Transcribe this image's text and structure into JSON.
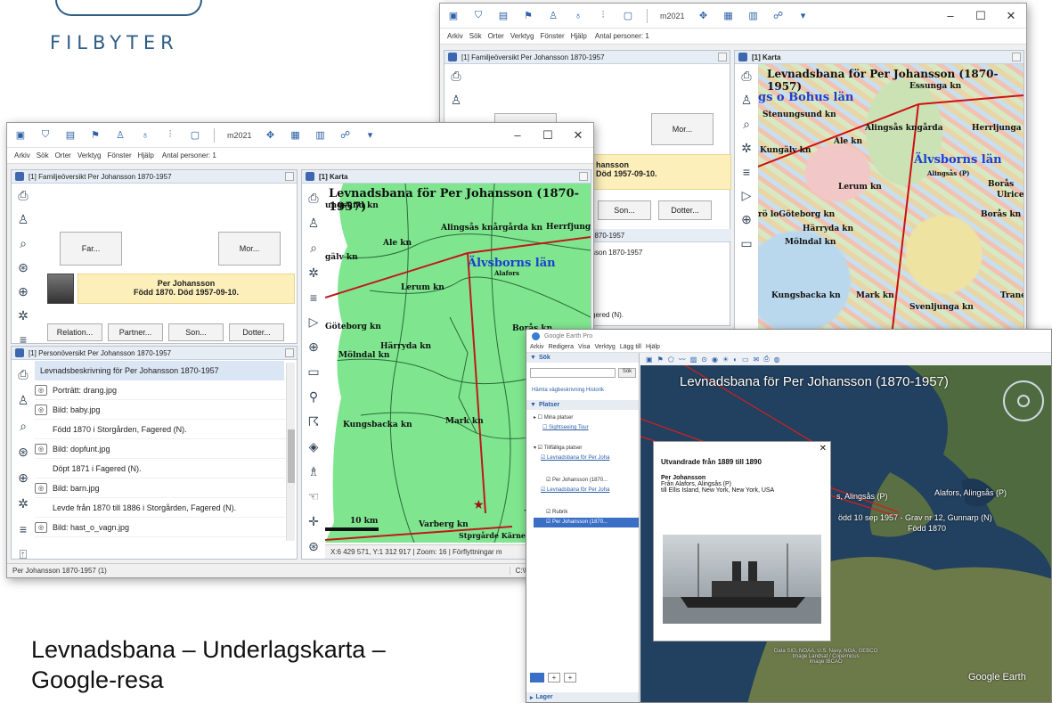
{
  "brand": {
    "word": "FILBYTER"
  },
  "caption": {
    "line1": "Levnadsbana – Underlagskarta –",
    "line2": "Google-resa"
  },
  "toolbar": {
    "year": "m2021"
  },
  "menu": {
    "items": [
      "Arkiv",
      "Sök",
      "Orter",
      "Verktyg",
      "Fönster",
      "Hjälp"
    ],
    "count": "Antal personer: 1"
  },
  "family": {
    "title": "[1] Familjeöversikt Per Johansson 1870-1957",
    "father": "Far...",
    "mother": "Mor...",
    "person_name": "Per Johansson",
    "person_dates": "Född 1870. Död 1957-09-10.",
    "buttons": [
      "Relation...",
      "Partner...",
      "Son...",
      "Dotter..."
    ]
  },
  "personview": {
    "title": "[1] Personöversikt Per Johansson 1870-1957",
    "header": "Levnadsbeskrivning för Per Johansson 1870-1957",
    "rows": [
      {
        "text": "Porträtt: drang.jpg",
        "photo": true
      },
      {
        "text": "Bild: baby.jpg",
        "photo": true
      },
      {
        "text": "Född 1870 i Storgården, Fagered (N).",
        "photo": false
      },
      {
        "text": "Bild: dopfunt.jpg",
        "photo": true
      },
      {
        "text": "Döpt 1871 i Fagered (N).",
        "photo": false
      },
      {
        "text": "Bild: barn.jpg",
        "photo": true
      },
      {
        "text": "Levde från 1870 till 1886 i Storgården, Fagered (N).",
        "photo": false
      },
      {
        "text": "Bild: hast_o_vagn.jpg",
        "photo": true
      }
    ]
  },
  "map": {
    "panel_title": "[1] Karta",
    "title": "Levnadsbana för Per Johansson (1870-1957)",
    "labels": [
      "Alingsås knårgårda kn",
      "Herrfjunga",
      "Ale kn",
      "Älvsborns län",
      "Alafors",
      "Lerum kn",
      "Göteborg kn",
      "Härryda kn",
      "Mölndal kn",
      "Borås kn",
      "Kungsbacka kn",
      "Mark kn",
      "Varberg kn",
      "Stprgårde Kärnebygd",
      "10 km",
      "ungsund kn",
      "gälv kn"
    ],
    "status": "X:6 429 571, Y:1 312 917  |  Zoom: 16  |  Förflyttningar m",
    "path": "C:\\Users\\Björn\\Disgen\\"
  },
  "statusbar": {
    "left": "Per Johansson 1870-1957 (1)"
  },
  "back_window": {
    "family_title": "[1] Familjeöversikt Per Johansson 1870-1957",
    "map_title": "[1] Karta",
    "map_heading": "Levnadsbana för Per Johansson (1870-1957)",
    "mother": "Mor...",
    "son": "Son...",
    "daughter": "Dotter...",
    "person_name": "hansson",
    "person_dates": "Död 1957-09-10.",
    "list_title": "1870-1957",
    "list_row": "sson 1870-1957",
    "list_row2": "gered (N).",
    "labels": [
      "Essunga kn",
      "gs o Bohus län",
      "Stenungsund kn",
      "Alingsås kngårda",
      "Herrljunga kn",
      "Ale kn",
      "Kungälv kn",
      "Älvsborns län",
      "Lerum kn",
      "Alingsås (P)",
      "Borås",
      "Ulrice",
      "rö loGöteborg kn",
      "Borås kn",
      "Härryda kn",
      "Mölndal kn",
      "Kungsbacka kn",
      "Mark kn",
      "Svenljunga kn",
      "Trane"
    ]
  },
  "google_earth": {
    "window_title": "Google Earth Pro",
    "menu": [
      "Arkiv",
      "Redigera",
      "Visa",
      "Verktyg",
      "Lägg till",
      "Hjälp"
    ],
    "search": "Sök",
    "search_btn": "Sök",
    "search_links": "Hämta vägbeskrivning   Historik",
    "places": "Platser",
    "tree": [
      "Mina platser",
      "Sightseeing Tour",
      "Tillfälliga platser",
      "Levnadsbana för Per Joha",
      "Per Johansson (1870...",
      "Levnadsbana för Per Joha",
      "Rubrik",
      "Per Johansson (1870..."
    ],
    "layers": "Lager",
    "title": "Levnadsbana för Per Johansson (1870-1957)",
    "popup_title": "Utvandrade från 1889 till 1890",
    "popup_name": "Per Johansson",
    "popup_from": "Från Alafors, Alingsås (P)",
    "popup_to": "till Ellis Island, New York, New York, USA",
    "labels": [
      "Alafors, Alingsås (P)",
      "s, Alingsås (P)",
      "ödd 10 sep 1957 - Grav nr 12, Gunnarp (N)",
      "Född 1870"
    ],
    "attribution": "Data SIO, NOAA, U.S. Navy, NGA, GEBCO\nImage Landsat / Copernicus\nImage IBCAO",
    "logo": "Google Earth"
  }
}
